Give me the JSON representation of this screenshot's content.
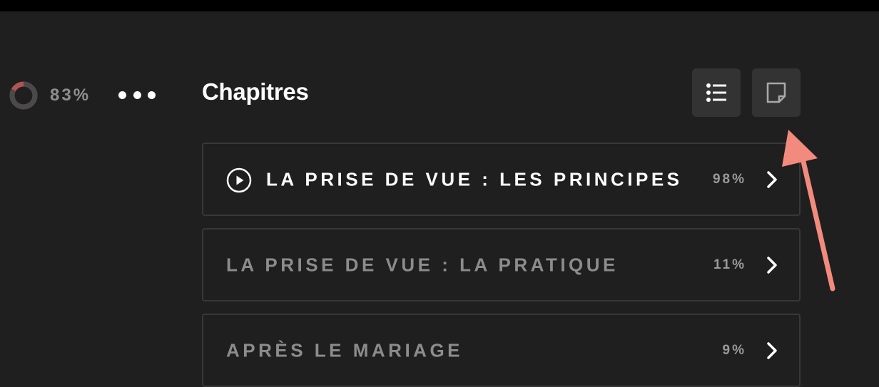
{
  "progress": {
    "percent_text": "83%",
    "value": 0.83,
    "track_color": "#b35454",
    "fill_color": "#4a4a4a"
  },
  "menu": {
    "icon": "more-horizontal-icon"
  },
  "section": {
    "title": "Chapitres"
  },
  "view_toggle": {
    "list_icon": "list-icon",
    "note_icon": "note-icon"
  },
  "chapters": [
    {
      "title": "LA PRISE DE VUE : LES PRINCIPES",
      "percent": "98%",
      "active": true
    },
    {
      "title": "LA PRISE DE VUE : LA PRATIQUE",
      "percent": "11%",
      "active": false
    },
    {
      "title": "APRÈS LE MARIAGE",
      "percent": "9%",
      "active": false
    }
  ],
  "annotation": {
    "color": "#f28b7e"
  }
}
